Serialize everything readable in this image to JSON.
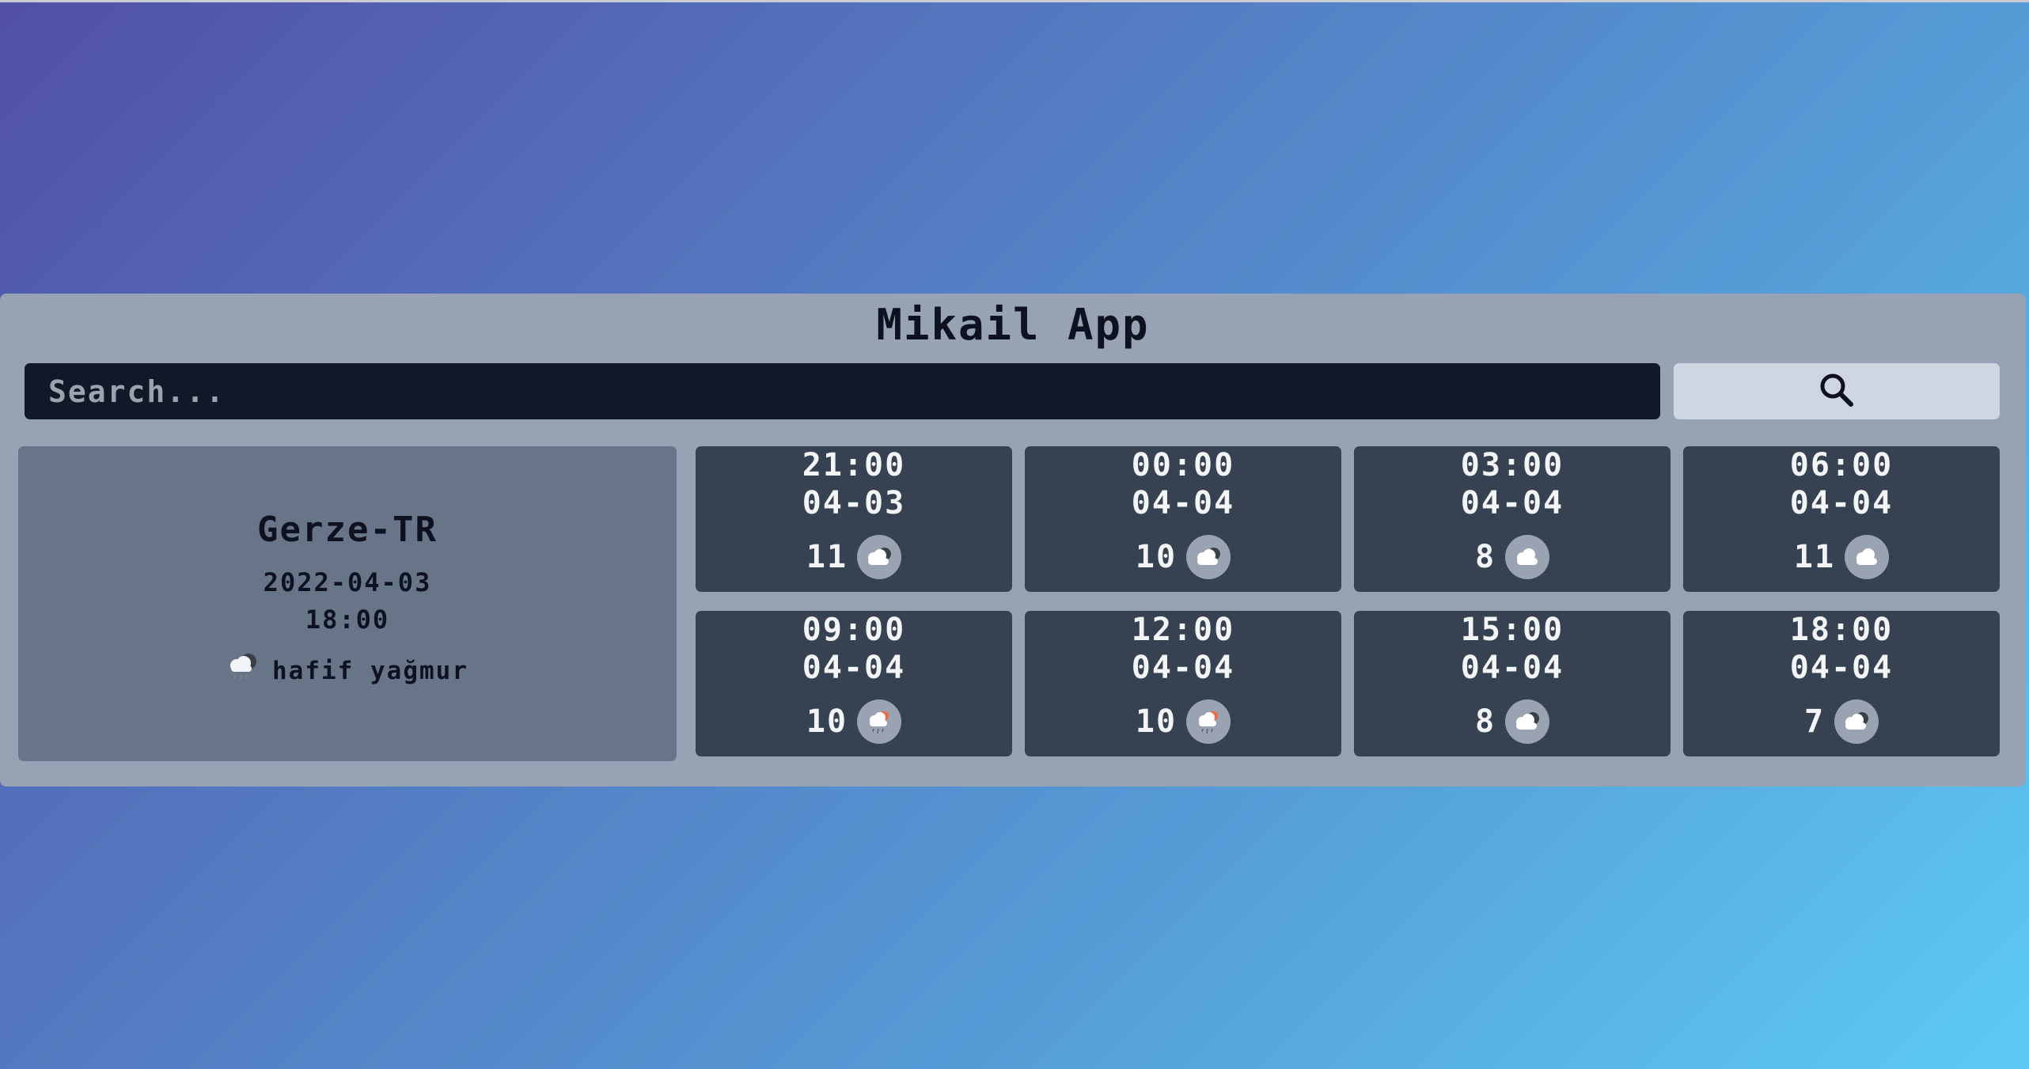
{
  "app": {
    "title": "Mikail App"
  },
  "search": {
    "placeholder": "Search...",
    "button_icon": "search-icon"
  },
  "current": {
    "city": "Gerze-TR",
    "date": "2022-04-03",
    "time": "18:00",
    "description": "hafif yağmur",
    "icon": "rain-cloud-icon"
  },
  "forecast": [
    {
      "time": "21:00",
      "date": "04-03",
      "temp": "11",
      "icon": "broken-clouds-icon"
    },
    {
      "time": "00:00",
      "date": "04-04",
      "temp": "10",
      "icon": "broken-clouds-icon"
    },
    {
      "time": "03:00",
      "date": "04-04",
      "temp": "8",
      "icon": "cloud-icon"
    },
    {
      "time": "06:00",
      "date": "04-04",
      "temp": "11",
      "icon": "cloud-icon"
    },
    {
      "time": "09:00",
      "date": "04-04",
      "temp": "10",
      "icon": "sun-rain-icon"
    },
    {
      "time": "12:00",
      "date": "04-04",
      "temp": "10",
      "icon": "sun-rain-icon"
    },
    {
      "time": "15:00",
      "date": "04-04",
      "temp": "8",
      "icon": "broken-clouds-icon"
    },
    {
      "time": "18:00",
      "date": "04-04",
      "temp": "7",
      "icon": "broken-clouds-icon"
    }
  ],
  "colors": {
    "panel": "#97a3b5",
    "card": "#364152",
    "current_card": "#687588",
    "search_input": "#111827",
    "search_button": "#cfd6e2"
  }
}
